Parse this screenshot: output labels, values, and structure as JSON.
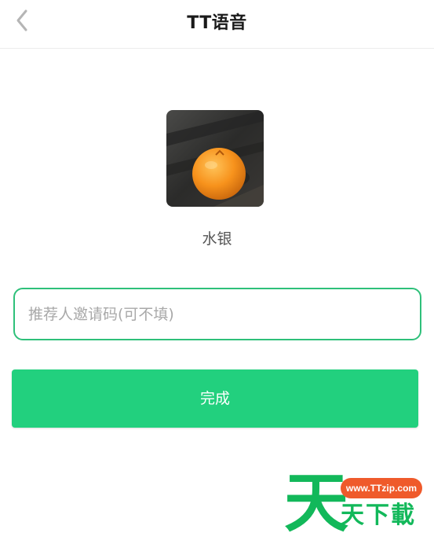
{
  "navbar": {
    "title": "TT语音",
    "back_icon": "chevron-left-icon"
  },
  "profile": {
    "avatar_description": "orange-photo-avatar",
    "nickname": "水银"
  },
  "invite": {
    "placeholder": "推荐人邀请码(可不填)",
    "value": ""
  },
  "actions": {
    "done_label": "完成"
  },
  "watermark": {
    "big_char": "天",
    "url": "www.TTzip.com",
    "text": "天下載"
  },
  "colors": {
    "accent_green": "#22d07e",
    "input_border": "#2ec07a",
    "watermark_green": "#12b85a",
    "watermark_pill": "#ef5a2b"
  }
}
